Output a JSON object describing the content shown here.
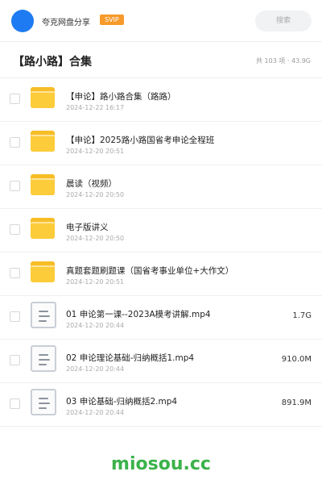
{
  "header": {
    "share_title": "夸克网盘分享",
    "badge": "SVIP",
    "search_placeholder": "搜索"
  },
  "folder": {
    "title": "【路小路】合集",
    "summary": "共 103 项 · 43.9G"
  },
  "items": [
    {
      "type": "folder",
      "name": "【申论】路小路合集（路路）",
      "date": "2024-12-22 16:17",
      "size": ""
    },
    {
      "type": "folder",
      "name": "【申论】2025路小路国省考申论全程班",
      "date": "2024-12-20 20:51",
      "size": ""
    },
    {
      "type": "folder",
      "name": "晨读（视频）",
      "date": "2024-12-20 20:50",
      "size": ""
    },
    {
      "type": "folder",
      "name": "电子版讲义",
      "date": "2024-12-20 20:50",
      "size": ""
    },
    {
      "type": "folder",
      "name": "真题套题刷题课（国省考事业单位+大作文）",
      "date": "2024-12-20 20:51",
      "size": ""
    },
    {
      "type": "file",
      "name": "01 申论第一课--2023A模考讲解.mp4",
      "date": "2024-12-20 20:44",
      "size": "1.7G"
    },
    {
      "type": "file",
      "name": "02 申论理论基础-归纳概括1.mp4",
      "date": "2024-12-20 20:44",
      "size": "910.0M"
    },
    {
      "type": "file",
      "name": "03 申论基础-归纳概括2.mp4",
      "date": "2024-12-20 20:44",
      "size": "891.9M"
    }
  ],
  "watermark": "miosou.cc",
  "colors": {
    "accent": "#1e7bf2",
    "badge": "#f79a2b",
    "folder": "#fccc3a",
    "watermark": "#3bb24a"
  }
}
